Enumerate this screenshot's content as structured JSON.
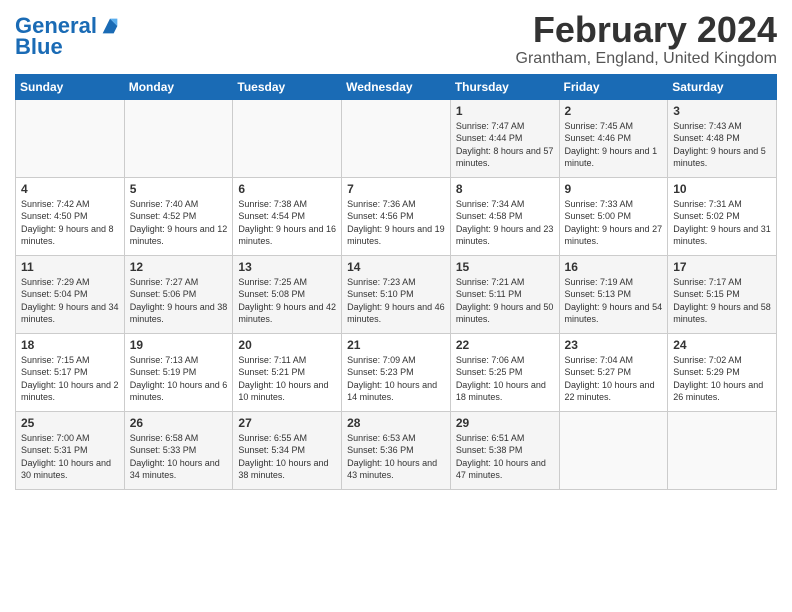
{
  "header": {
    "logo_line1": "General",
    "logo_line2": "Blue",
    "month": "February 2024",
    "location": "Grantham, England, United Kingdom"
  },
  "weekdays": [
    "Sunday",
    "Monday",
    "Tuesday",
    "Wednesday",
    "Thursday",
    "Friday",
    "Saturday"
  ],
  "weeks": [
    [
      {
        "day": "",
        "info": ""
      },
      {
        "day": "",
        "info": ""
      },
      {
        "day": "",
        "info": ""
      },
      {
        "day": "",
        "info": ""
      },
      {
        "day": "1",
        "info": "Sunrise: 7:47 AM\nSunset: 4:44 PM\nDaylight: 8 hours and 57 minutes."
      },
      {
        "day": "2",
        "info": "Sunrise: 7:45 AM\nSunset: 4:46 PM\nDaylight: 9 hours and 1 minute."
      },
      {
        "day": "3",
        "info": "Sunrise: 7:43 AM\nSunset: 4:48 PM\nDaylight: 9 hours and 5 minutes."
      }
    ],
    [
      {
        "day": "4",
        "info": "Sunrise: 7:42 AM\nSunset: 4:50 PM\nDaylight: 9 hours and 8 minutes."
      },
      {
        "day": "5",
        "info": "Sunrise: 7:40 AM\nSunset: 4:52 PM\nDaylight: 9 hours and 12 minutes."
      },
      {
        "day": "6",
        "info": "Sunrise: 7:38 AM\nSunset: 4:54 PM\nDaylight: 9 hours and 16 minutes."
      },
      {
        "day": "7",
        "info": "Sunrise: 7:36 AM\nSunset: 4:56 PM\nDaylight: 9 hours and 19 minutes."
      },
      {
        "day": "8",
        "info": "Sunrise: 7:34 AM\nSunset: 4:58 PM\nDaylight: 9 hours and 23 minutes."
      },
      {
        "day": "9",
        "info": "Sunrise: 7:33 AM\nSunset: 5:00 PM\nDaylight: 9 hours and 27 minutes."
      },
      {
        "day": "10",
        "info": "Sunrise: 7:31 AM\nSunset: 5:02 PM\nDaylight: 9 hours and 31 minutes."
      }
    ],
    [
      {
        "day": "11",
        "info": "Sunrise: 7:29 AM\nSunset: 5:04 PM\nDaylight: 9 hours and 34 minutes."
      },
      {
        "day": "12",
        "info": "Sunrise: 7:27 AM\nSunset: 5:06 PM\nDaylight: 9 hours and 38 minutes."
      },
      {
        "day": "13",
        "info": "Sunrise: 7:25 AM\nSunset: 5:08 PM\nDaylight: 9 hours and 42 minutes."
      },
      {
        "day": "14",
        "info": "Sunrise: 7:23 AM\nSunset: 5:10 PM\nDaylight: 9 hours and 46 minutes."
      },
      {
        "day": "15",
        "info": "Sunrise: 7:21 AM\nSunset: 5:11 PM\nDaylight: 9 hours and 50 minutes."
      },
      {
        "day": "16",
        "info": "Sunrise: 7:19 AM\nSunset: 5:13 PM\nDaylight: 9 hours and 54 minutes."
      },
      {
        "day": "17",
        "info": "Sunrise: 7:17 AM\nSunset: 5:15 PM\nDaylight: 9 hours and 58 minutes."
      }
    ],
    [
      {
        "day": "18",
        "info": "Sunrise: 7:15 AM\nSunset: 5:17 PM\nDaylight: 10 hours and 2 minutes."
      },
      {
        "day": "19",
        "info": "Sunrise: 7:13 AM\nSunset: 5:19 PM\nDaylight: 10 hours and 6 minutes."
      },
      {
        "day": "20",
        "info": "Sunrise: 7:11 AM\nSunset: 5:21 PM\nDaylight: 10 hours and 10 minutes."
      },
      {
        "day": "21",
        "info": "Sunrise: 7:09 AM\nSunset: 5:23 PM\nDaylight: 10 hours and 14 minutes."
      },
      {
        "day": "22",
        "info": "Sunrise: 7:06 AM\nSunset: 5:25 PM\nDaylight: 10 hours and 18 minutes."
      },
      {
        "day": "23",
        "info": "Sunrise: 7:04 AM\nSunset: 5:27 PM\nDaylight: 10 hours and 22 minutes."
      },
      {
        "day": "24",
        "info": "Sunrise: 7:02 AM\nSunset: 5:29 PM\nDaylight: 10 hours and 26 minutes."
      }
    ],
    [
      {
        "day": "25",
        "info": "Sunrise: 7:00 AM\nSunset: 5:31 PM\nDaylight: 10 hours and 30 minutes."
      },
      {
        "day": "26",
        "info": "Sunrise: 6:58 AM\nSunset: 5:33 PM\nDaylight: 10 hours and 34 minutes."
      },
      {
        "day": "27",
        "info": "Sunrise: 6:55 AM\nSunset: 5:34 PM\nDaylight: 10 hours and 38 minutes."
      },
      {
        "day": "28",
        "info": "Sunrise: 6:53 AM\nSunset: 5:36 PM\nDaylight: 10 hours and 43 minutes."
      },
      {
        "day": "29",
        "info": "Sunrise: 6:51 AM\nSunset: 5:38 PM\nDaylight: 10 hours and 47 minutes."
      },
      {
        "day": "",
        "info": ""
      },
      {
        "day": "",
        "info": ""
      }
    ]
  ]
}
